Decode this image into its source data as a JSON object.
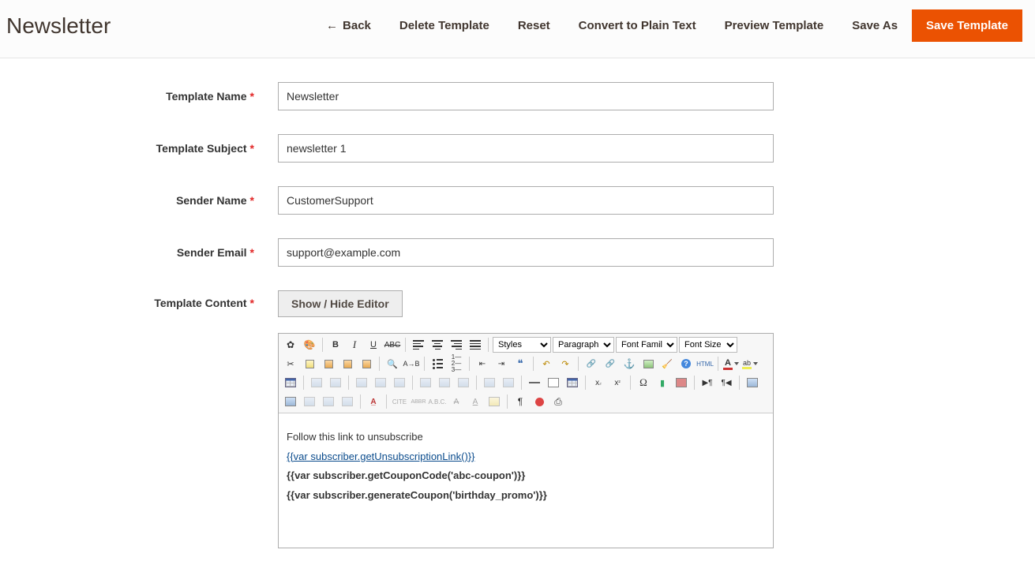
{
  "page": {
    "title": "Newsletter"
  },
  "toolbar": {
    "back": "Back",
    "delete": "Delete Template",
    "reset": "Reset",
    "convert": "Convert to Plain Text",
    "preview": "Preview Template",
    "save_as": "Save As",
    "save": "Save Template"
  },
  "form": {
    "labels": {
      "name": "Template Name",
      "subject": "Template Subject",
      "sender_name": "Sender Name",
      "sender_email": "Sender Email",
      "content": "Template Content"
    },
    "values": {
      "name": "Newsletter",
      "subject": "newsletter 1",
      "sender_name": "CustomerSupport",
      "sender_email": "support@example.com"
    },
    "toggle_editor": "Show / Hide Editor"
  },
  "editor": {
    "dropdowns": {
      "styles": "Styles",
      "paragraph": "Paragraph",
      "font_family": "Font Family",
      "font_size": "Font Size"
    },
    "content": {
      "line1": "Follow this link to unsubscribe",
      "line2": "{{var subscriber.getUnsubscriptionLink()}}",
      "line3": "{{var subscriber.getCouponCode('abc-coupon')}}",
      "line4": "{{var subscriber.generateCoupon('birthday_promo')}}"
    }
  }
}
